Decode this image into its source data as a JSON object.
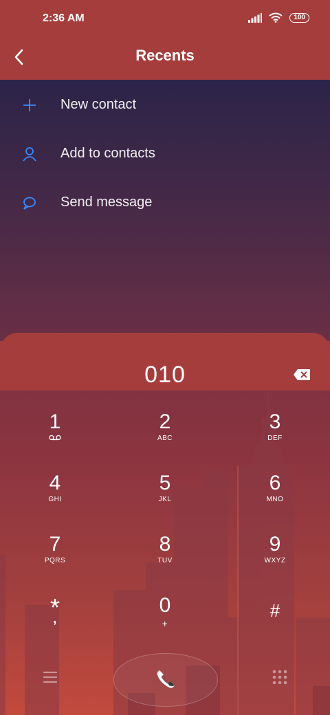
{
  "status": {
    "time": "2:36 AM",
    "battery": "100"
  },
  "appbar": {
    "title": "Recents",
    "back_icon": "back-arrow-icon"
  },
  "menu": [
    {
      "label": "New contact",
      "icon": "plus-icon"
    },
    {
      "label": "Add to contacts",
      "icon": "person-icon"
    },
    {
      "label": "Send message",
      "icon": "message-bubble-icon"
    }
  ],
  "dialer": {
    "number": "010",
    "keys": [
      {
        "digit": "1",
        "letters": "",
        "sub_icon": "voicemail-icon"
      },
      {
        "digit": "2",
        "letters": "ABC"
      },
      {
        "digit": "3",
        "letters": "DEF"
      },
      {
        "digit": "4",
        "letters": "GHI"
      },
      {
        "digit": "5",
        "letters": "JKL"
      },
      {
        "digit": "6",
        "letters": "MNO"
      },
      {
        "digit": "7",
        "letters": "PQRS"
      },
      {
        "digit": "8",
        "letters": "TUV"
      },
      {
        "digit": "9",
        "letters": "WXYZ"
      },
      {
        "digit": "*",
        "letters": ","
      },
      {
        "digit": "0",
        "letters": "+"
      },
      {
        "digit": "#",
        "letters": ""
      }
    ]
  },
  "colors": {
    "accent_blue": "#3a8bff",
    "bar_red": "#a63d3d"
  }
}
